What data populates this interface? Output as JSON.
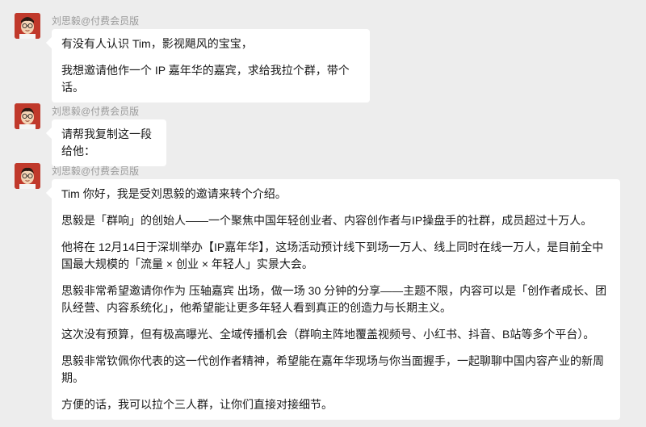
{
  "messages": [
    {
      "sender": "刘思毅@付费会员版",
      "paragraphs": [
        "有没有人认识 Tim，影视飓风的宝宝，",
        "我想邀请他作一个 IP 嘉年华的嘉宾，求给我拉个群，带个话。"
      ]
    },
    {
      "sender": "刘思毅@付费会员版",
      "paragraphs": [
        "请帮我复制这一段给他："
      ]
    },
    {
      "sender": "刘思毅@付费会员版",
      "paragraphs": [
        "Tim 你好，我是受刘思毅的邀请来转个介绍。",
        "思毅是「群响」的创始人——一个聚焦中国年轻创业者、内容创作者与IP操盘手的社群，成员超过十万人。",
        "他将在 12月14日于深圳举办【IP嘉年华】，这场活动预计线下到场一万人、线上同时在线一万人，是目前全中国最大规模的「流量 × 创业 × 年轻人」实景大会。",
        "思毅非常希望邀请你作为 压轴嘉宾 出场，做一场 30 分钟的分享——主题不限，内容可以是「创作者成长、团队经营、内容系统化」，他希望能让更多年轻人看到真正的创造力与长期主义。",
        "这次没有预算，但有极高曝光、全域传播机会（群响主阵地覆盖视频号、小红书、抖音、B站等多个平台）。",
        "思毅非常钦佩你代表的这一代创作者精神，希望能在嘉年华现场与你当面握手，一起聊聊中国内容产业的新周期。",
        "方便的话，我可以拉个三人群，让你们直接对接细节。"
      ]
    }
  ]
}
